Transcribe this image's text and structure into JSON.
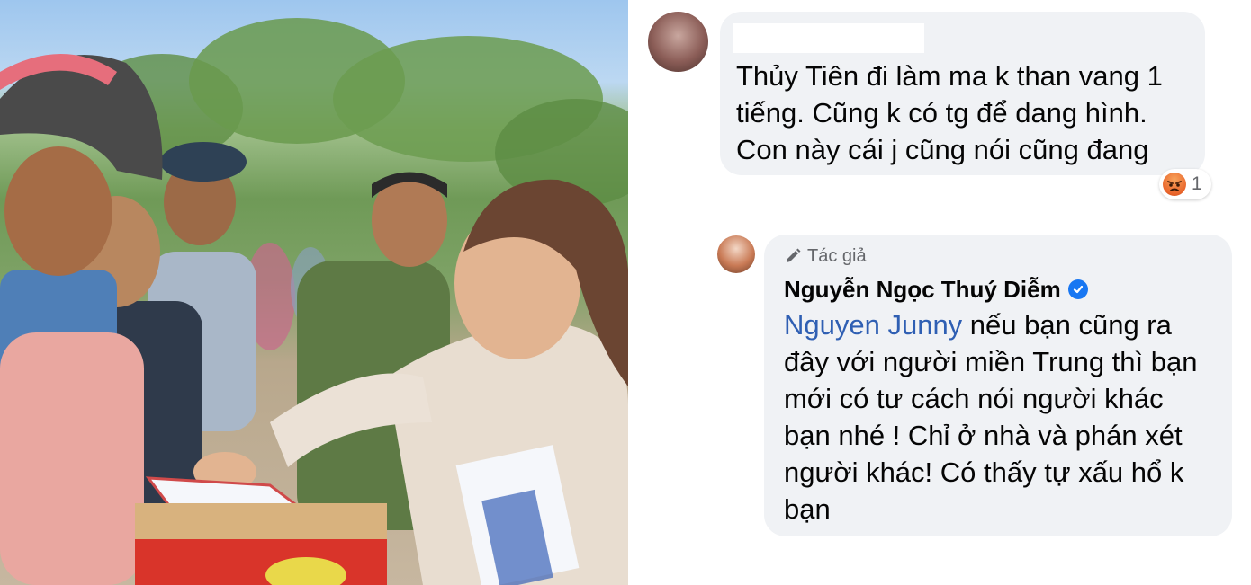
{
  "photo": {
    "description_icon": "photo-image"
  },
  "comments": [
    {
      "author_name_hidden": true,
      "text_lines": [
        "Thủy Tiên đi làm ma k than vang 1",
        "tiếng. Cũng k có tg để dang hình.",
        "Con này cái j cũng nói cũng đang"
      ],
      "reaction": {
        "icon": "angry-reaction-icon",
        "count": "1"
      }
    },
    {
      "author_tag": "Tác giả",
      "author_name": "Nguyễn Ngọc Thuý Diễm",
      "verified": true,
      "mention": "Nguyen Junny",
      "text_lines": [
        " nếu bạn cũng ra",
        "đây với người miền Trung thì bạn",
        "mới có tư cách nói người khác",
        "bạn nhé ! Chỉ ở nhà và phán xét",
        "người khác! Có thấy tự xấu hổ k",
        "bạn"
      ]
    }
  ],
  "colors": {
    "bubble": "#f0f2f5",
    "mention": "#2f5fb3",
    "verified": "#1877f2",
    "muted": "#65676b"
  }
}
